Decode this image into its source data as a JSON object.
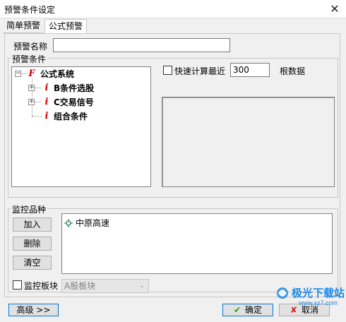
{
  "window": {
    "title": "预警条件设定",
    "close_glyph": "✕"
  },
  "tabs": [
    {
      "label": "简单预警",
      "active": false
    },
    {
      "label": "公式预警",
      "active": true
    }
  ],
  "warning_name": {
    "label": "预警名称",
    "value": ""
  },
  "warning_condition": {
    "caption": "预警条件",
    "tree": {
      "root": {
        "icon": "F",
        "label": "公式系统"
      },
      "items": [
        {
          "icon": "i",
          "label": "B条件选股",
          "expandable": true
        },
        {
          "icon": "i",
          "label": "C交易信号",
          "expandable": true
        },
        {
          "icon": "i",
          "label": "组合条件",
          "expandable": false
        }
      ]
    },
    "fast_calc": {
      "checked": false,
      "label_prefix": "快速计算最近",
      "value": "300",
      "label_suffix": "根数据"
    }
  },
  "monitor": {
    "caption": "监控品种",
    "buttons": {
      "add": "加入",
      "delete": "删除",
      "clear": "清空"
    },
    "items": [
      {
        "label": "中原高速",
        "icon": "stock-icon"
      }
    ],
    "board": {
      "checked": false,
      "label": "监控板块",
      "select_value": "A股板块"
    }
  },
  "footer": {
    "advanced": "高级 >>",
    "ok": "确定",
    "cancel": "取消"
  },
  "watermark": {
    "text": "极光下载站",
    "url_text": "www.xz7.com"
  },
  "colors": {
    "accent": "#0078d7",
    "tree_icon": "#d40000",
    "watermark_blue": "#1e88e5"
  }
}
